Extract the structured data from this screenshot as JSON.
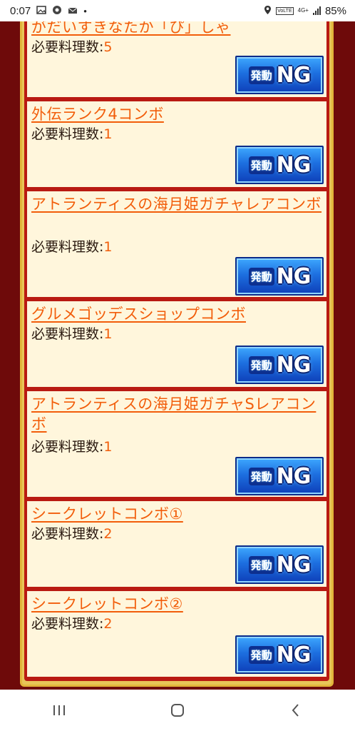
{
  "status_bar": {
    "time": "0:07",
    "network_badge": "VoLTE",
    "network_type": "4G+",
    "battery": "85%",
    "icons": [
      "image-icon",
      "chrome-icon",
      "mail-icon",
      "dot-icon",
      "location-icon",
      "wifi-icon",
      "signal-icon",
      "battery-icon"
    ]
  },
  "combos": [
    {
      "title": "がだいすきなたか「ぴ」しゃ",
      "req_label": "必要料理数:",
      "req_value": "5",
      "button_kanji": "発動",
      "button_text": "NG"
    },
    {
      "title": "外伝ランク4コンボ",
      "req_label": "必要料理数:",
      "req_value": "1",
      "button_kanji": "発動",
      "button_text": "NG"
    },
    {
      "title": "アトランティスの海月姫ガチャレアコンボ",
      "req_label": "必要料理数:",
      "req_value": "1",
      "button_kanji": "発動",
      "button_text": "NG"
    },
    {
      "title": "グルメゴッデスショップコンボ",
      "req_label": "必要料理数:",
      "req_value": "1",
      "button_kanji": "発動",
      "button_text": "NG"
    },
    {
      "title": "アトランティスの海月姫ガチャSレアコンボ",
      "req_label": "必要料理数:",
      "req_value": "1",
      "button_kanji": "発動",
      "button_text": "NG"
    },
    {
      "title": "シークレットコンボ①",
      "req_label": "必要料理数:",
      "req_value": "2",
      "button_kanji": "発動",
      "button_text": "NG"
    },
    {
      "title": "シークレットコンボ②",
      "req_label": "必要料理数:",
      "req_value": "2",
      "button_kanji": "発動",
      "button_text": "NG"
    }
  ],
  "nav_bar": {
    "buttons": [
      "recents-icon",
      "home-icon",
      "back-icon"
    ]
  },
  "colors": {
    "background": "#6e0a0a",
    "panel_border": "#e8c558",
    "item_separator": "#b91a12",
    "item_bg": "#fff6dc",
    "link": "#f25d0a",
    "button_blue": "#1d6fe0"
  }
}
